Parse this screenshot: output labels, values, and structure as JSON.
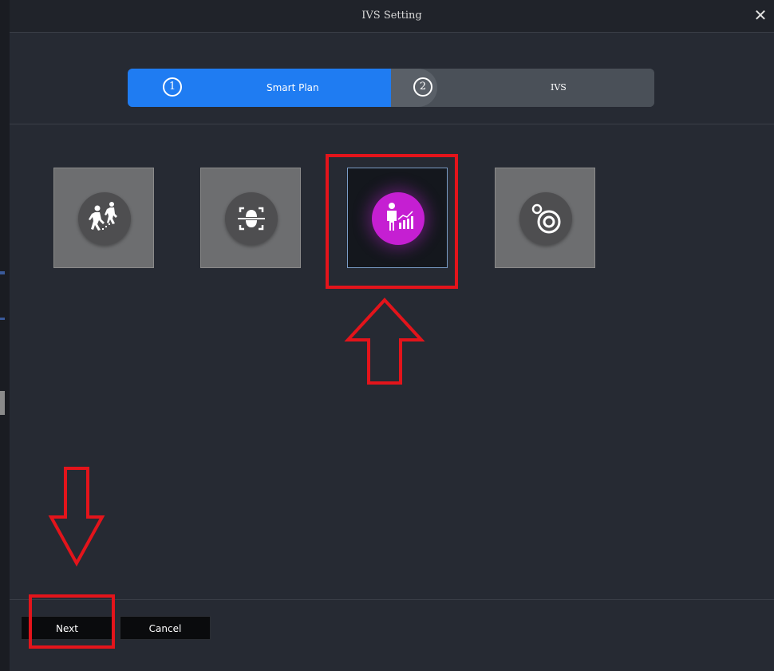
{
  "dialog": {
    "title": "IVS Setting",
    "close_glyph": "✕"
  },
  "steps": [
    {
      "number": "1",
      "label": "Smart Plan",
      "state": "active"
    },
    {
      "number": "2",
      "label": "IVS",
      "state": "inactive"
    }
  ],
  "smart_plans": [
    {
      "icon": "people-counting-icon",
      "selected": false
    },
    {
      "icon": "face-recognition-icon",
      "selected": false
    },
    {
      "icon": "crowd-statistics-icon",
      "selected": true
    },
    {
      "icon": "target-detection-icon",
      "selected": false
    }
  ],
  "buttons": {
    "next_label": "Next",
    "cancel_label": "Cancel"
  },
  "annotations": {
    "color": "#e3141b",
    "up_arrow": "points-at-selected-tile",
    "down_arrow": "points-at-next-button"
  },
  "colors": {
    "accent": "#1f7cf2",
    "dialog_bg": "#262a33",
    "selected_icon": "#c51fd2"
  }
}
